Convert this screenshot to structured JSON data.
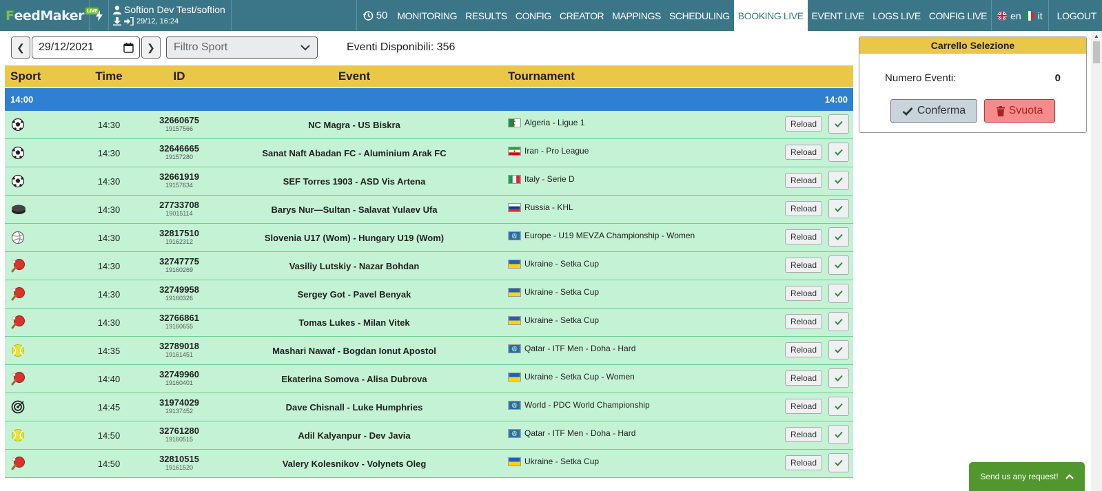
{
  "header": {
    "logo": {
      "first": "F",
      "rest": "eedMaker",
      "badge": "LIVE"
    },
    "user": "Softion Dev Test/softion",
    "download_time": "29/12, 16:24",
    "history_count": "50",
    "nav": [
      "MONITORING",
      "RESULTS",
      "CONFIG",
      "CREATOR",
      "MAPPINGS",
      "SCHEDULING",
      "BOOKING LIVE",
      "EVENT LIVE",
      "LOGS LIVE",
      "CONFIG LIVE"
    ],
    "active_nav": "BOOKING LIVE",
    "lang_en": "en",
    "lang_it": "it",
    "logout": "LOGOUT"
  },
  "toolbar": {
    "date": "29/12/2021",
    "sport_filter": "Filtro Sport",
    "available": "Eventi Disponibili: 356"
  },
  "table": {
    "headers": {
      "sport": "Sport",
      "time": "Time",
      "id": "ID",
      "event": "Event",
      "tournament": "Tournament"
    },
    "group": {
      "left": "14:00",
      "right": "14:00"
    },
    "rows": [
      {
        "sport": "soccer",
        "time": "14:30",
        "id": "32660675",
        "subid": "19157566",
        "event": "NC Magra - US Biskra",
        "flag": "algeria",
        "tournament": "Algeria - Ligue 1"
      },
      {
        "sport": "soccer",
        "time": "14:30",
        "id": "32646665",
        "subid": "19157280",
        "event": "Sanat Naft Abadan FC - Aluminium Arak FC",
        "flag": "iran",
        "tournament": "Iran - Pro League"
      },
      {
        "sport": "soccer",
        "time": "14:30",
        "id": "32661919",
        "subid": "19157634",
        "event": "SEF Torres 1903 - ASD Vis Artena",
        "flag": "italy",
        "tournament": "Italy - Serie D"
      },
      {
        "sport": "hockey",
        "time": "14:30",
        "id": "27733708",
        "subid": "19015114",
        "event": "Barys Nur—Sultan - Salavat Yulaev Ufa",
        "flag": "russia",
        "tournament": "Russia - KHL"
      },
      {
        "sport": "volleyball",
        "time": "14:30",
        "id": "32817510",
        "subid": "19162312",
        "event": "Slovenia U17 (Wom) - Hungary U19 (Wom)",
        "flag": "world",
        "tournament": "Europe - U19 MEVZA Championship - Women"
      },
      {
        "sport": "table-tennis",
        "time": "14:30",
        "id": "32747775",
        "subid": "19160269",
        "event": "Vasiliy Lutskiy - Nazar Bohdan",
        "flag": "ukraine",
        "tournament": "Ukraine - Setka Cup"
      },
      {
        "sport": "table-tennis",
        "time": "14:30",
        "id": "32749958",
        "subid": "19160326",
        "event": "Sergey Got - Pavel Benyak",
        "flag": "ukraine",
        "tournament": "Ukraine - Setka Cup"
      },
      {
        "sport": "table-tennis",
        "time": "14:30",
        "id": "32766861",
        "subid": "19160655",
        "event": "Tomas Lukes - Milan Vitek",
        "flag": "ukraine",
        "tournament": "Ukraine - Setka Cup"
      },
      {
        "sport": "tennis",
        "time": "14:35",
        "id": "32789018",
        "subid": "19161451",
        "event": "Mashari Nawaf - Bogdan Ionut Apostol",
        "flag": "world",
        "tournament": "Qatar - ITF Men - Doha - Hard"
      },
      {
        "sport": "table-tennis",
        "time": "14:40",
        "id": "32749960",
        "subid": "19160401",
        "event": "Ekaterina Somova - Alisa Dubrova",
        "flag": "ukraine",
        "tournament": "Ukraine - Setka Cup - Women"
      },
      {
        "sport": "darts",
        "time": "14:45",
        "id": "31974029",
        "subid": "19137452",
        "event": "Dave Chisnall - Luke Humphries",
        "flag": "world",
        "tournament": "World - PDC World Championship"
      },
      {
        "sport": "tennis",
        "time": "14:50",
        "id": "32761280",
        "subid": "19160515",
        "event": "Adil Kalyanpur - Dev Javia",
        "flag": "world",
        "tournament": "Qatar - ITF Men - Doha - Hard"
      },
      {
        "sport": "table-tennis",
        "time": "14:50",
        "id": "32810515",
        "subid": "19161520",
        "event": "Valery Kolesnikov - Volynets Oleg",
        "flag": "ukraine",
        "tournament": "Ukraine - Setka Cup"
      }
    ],
    "reload_label": "Reload"
  },
  "cart": {
    "title": "Carrello Selezione",
    "count_label": "Numero Eventi:",
    "count_value": "0",
    "confirm": "Conferma",
    "clear": "Svuota"
  },
  "help": {
    "label": "Send us any request!"
  }
}
